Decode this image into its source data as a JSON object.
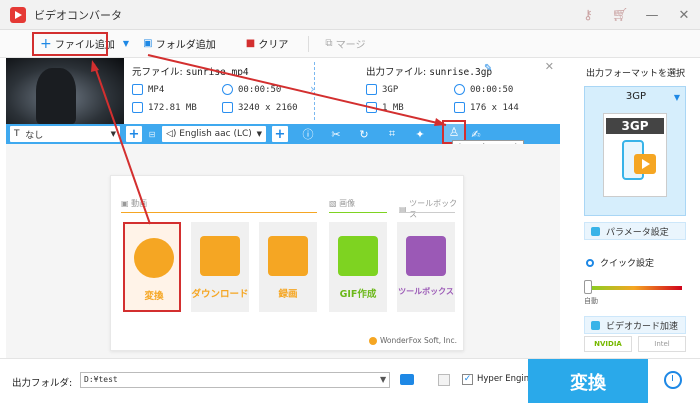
{
  "app": {
    "title": "ビデオコンバータ"
  },
  "toolbar": {
    "add_file": "ファイル追加",
    "add_folder": "フォルダ追加",
    "clear": "クリア",
    "merge": "マージ"
  },
  "file": {
    "source_label": "元ファイル:",
    "source_name": "sunrise.mp4",
    "source_format": "MP4",
    "source_duration": "00:00:50",
    "source_size": "172.81 MB",
    "source_resolution": "3240 x 2160",
    "output_label": "出力ファイル:",
    "output_name": "sunrise.3gp",
    "output_format": "3GP",
    "output_duration": "00:00:50",
    "output_size": "1 MB",
    "output_resolution": "176 x 144"
  },
  "editbar": {
    "subtitle": "なし",
    "audio": "English aac (LC)",
    "tooltip": "ウォーターマーク"
  },
  "launcher": {
    "sections": [
      "動画",
      "画像",
      "ツールボックス"
    ],
    "tiles": [
      {
        "label": "変換",
        "color": "#f5a623"
      },
      {
        "label": "ダウンロード",
        "color": "#f5a623"
      },
      {
        "label": "録画",
        "color": "#f5a623"
      },
      {
        "label": "GIF作成",
        "color": "#7ed321"
      },
      {
        "label": "ツールボックス",
        "color": "#9b59b6"
      }
    ],
    "credit": "WonderFox Soft, Inc."
  },
  "right_panel": {
    "title": "出力フォーマットを選択",
    "format": "3GP",
    "params": "パラメータ設定",
    "quick": "クイック設定",
    "slider_label": "自動",
    "gpu": "ビデオカード加速",
    "nvidia": "NVIDIA",
    "intel": "Intel"
  },
  "bottom": {
    "output_folder_label": "出力フォルダ:",
    "output_folder_value": "D:¥test",
    "hyper_engine": "Hyper Engine",
    "convert": "変換"
  },
  "colors": {
    "accent": "#2aa9ea",
    "highlight": "#d32f2f",
    "orange": "#f5a623"
  }
}
